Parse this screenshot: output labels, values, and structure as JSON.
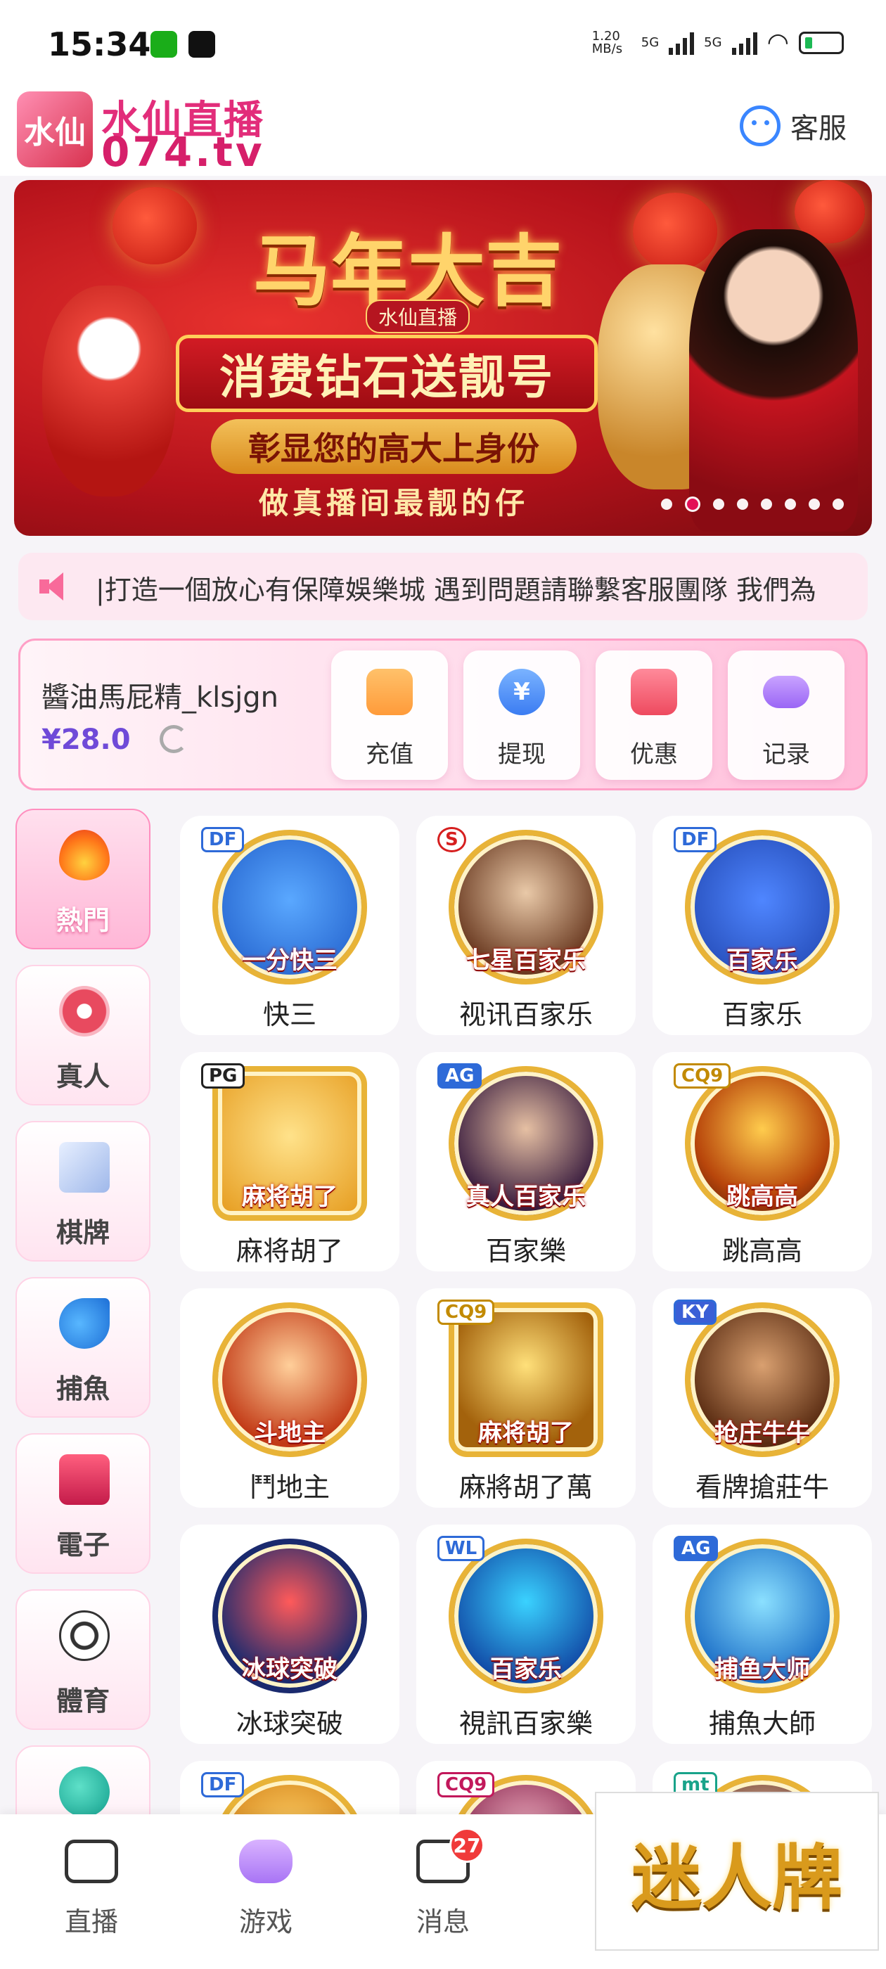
{
  "status_bar": {
    "time": "15:34",
    "network_speed": "1.20 MB/s",
    "net1": "5G",
    "net2": "5G"
  },
  "header": {
    "brand_name": "水仙直播",
    "brand_domain": "074.tv",
    "logo_text": "水仙",
    "service_label": "客服"
  },
  "banner": {
    "title": "马年大吉",
    "subtitle_small": "水仙直播",
    "line1": "消费钻石送靓号",
    "line2": "彰显您的高大上身份",
    "line3": "做真播间最靓的仔",
    "slide_count": 8,
    "active_slide": 2
  },
  "marquee": {
    "text": "|打造一個放心有保障娛樂城  遇到問題請聯繫客服團隊 我們為"
  },
  "account": {
    "username": "醬油馬屁精_klsjgn",
    "balance": "¥28.0",
    "actions": [
      {
        "label": "充值",
        "icon": "wallet-icon"
      },
      {
        "label": "提现",
        "icon": "yen-coin-icon",
        "glyph": "¥"
      },
      {
        "label": "优惠",
        "icon": "coupon-icon"
      },
      {
        "label": "记录",
        "icon": "gamepad-icon"
      }
    ]
  },
  "categories": [
    {
      "label": "熱門",
      "icon": "flame-icon",
      "active": true
    },
    {
      "label": "真人",
      "icon": "chip-icon",
      "active": false
    },
    {
      "label": "棋牌",
      "icon": "playing-cards-icon",
      "active": false
    },
    {
      "label": "捕魚",
      "icon": "shark-icon",
      "active": false
    },
    {
      "label": "電子",
      "icon": "slot-777-icon",
      "active": false
    },
    {
      "label": "體育",
      "icon": "soccer-ball-icon",
      "active": false
    },
    {
      "label": "",
      "icon": "lottery-ball-icon",
      "active": false
    }
  ],
  "games": [
    {
      "name": "快三",
      "provider": "DF",
      "tag": "一分快三"
    },
    {
      "name": "视讯百家乐",
      "provider": "S",
      "tag": "七星百家乐"
    },
    {
      "name": "百家乐",
      "provider": "DF",
      "tag": "百家乐"
    },
    {
      "name": "麻将胡了",
      "provider": "PG",
      "tag": "麻将胡了"
    },
    {
      "name": "百家樂",
      "provider": "AG",
      "tag": "真人百家乐"
    },
    {
      "name": "跳高高",
      "provider": "CQ9",
      "tag": "跳高高"
    },
    {
      "name": "鬥地主",
      "provider": "",
      "tag": "斗地主"
    },
    {
      "name": "麻將胡了萬",
      "provider": "CQ9",
      "tag": "麻将胡了"
    },
    {
      "name": "看牌搶莊牛",
      "provider": "KY",
      "tag": "抢庄牛牛"
    },
    {
      "name": "冰球突破",
      "provider": "",
      "tag": "冰球突破"
    },
    {
      "name": "視訊百家樂",
      "provider": "WL",
      "tag": "百家乐"
    },
    {
      "name": "捕魚大師",
      "provider": "AG",
      "tag": "捕鱼大师"
    },
    {
      "name": "",
      "provider": "DF",
      "tag": ""
    },
    {
      "name": "",
      "provider": "CQ9",
      "tag": ""
    },
    {
      "name": "",
      "provider": "mt",
      "tag": ""
    }
  ],
  "bottom_nav": [
    {
      "label": "直播",
      "icon": "camera-icon"
    },
    {
      "label": "游戏",
      "icon": "gamepad-icon"
    },
    {
      "label": "消息",
      "icon": "message-icon",
      "badge": "27"
    }
  ],
  "float_ad": {
    "text": "迷人牌"
  }
}
